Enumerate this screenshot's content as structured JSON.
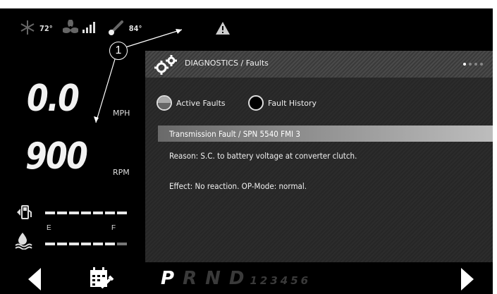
{
  "status_bar": {
    "icons": [
      "snowflake-icon",
      "fan-icon",
      "signal-icon",
      "thermometer-icon"
    ],
    "ac_temp": "72°",
    "outside_temp": "84°",
    "warning_icon": "warning-triangle-icon"
  },
  "callout_number": "1",
  "gauges": {
    "speed_value": "0.0",
    "speed_unit": "MPH",
    "rpm_value": "900",
    "rpm_unit": "RPM",
    "fuel_icon": "fuel-pump-icon",
    "def_icon": "def-fluid-icon",
    "empty_label": "E",
    "full_label": "F",
    "fuel_level_fraction": 1.0,
    "def_level_fraction": 0.85
  },
  "diagnostics": {
    "title": "DIAGNOSTICS / Faults",
    "tabs": [
      {
        "label": "Active Faults",
        "selected": true
      },
      {
        "label": "Fault History",
        "selected": false
      }
    ],
    "page_dots": 4,
    "current_page": 1,
    "fault": {
      "title": "Transmission Fault / SPN 5540 FMI 3",
      "reason": "Reason: S.C. to battery voltage at converter clutch.",
      "effect": "Effect: No reaction. OP-Mode: normal."
    }
  },
  "bottom_bar": {
    "left_arrow_icon": "chevron-left-icon",
    "right_arrow_icon": "chevron-right-icon",
    "calendar_icon": "calendar-wrench-icon",
    "gears": [
      "P",
      "R",
      "N",
      "D"
    ],
    "active_gear": "P",
    "gear_numbers": "123456"
  },
  "colors": {
    "background": "#000000",
    "text": "#f0f0f0",
    "dim_gear": "#3a3a3a"
  }
}
